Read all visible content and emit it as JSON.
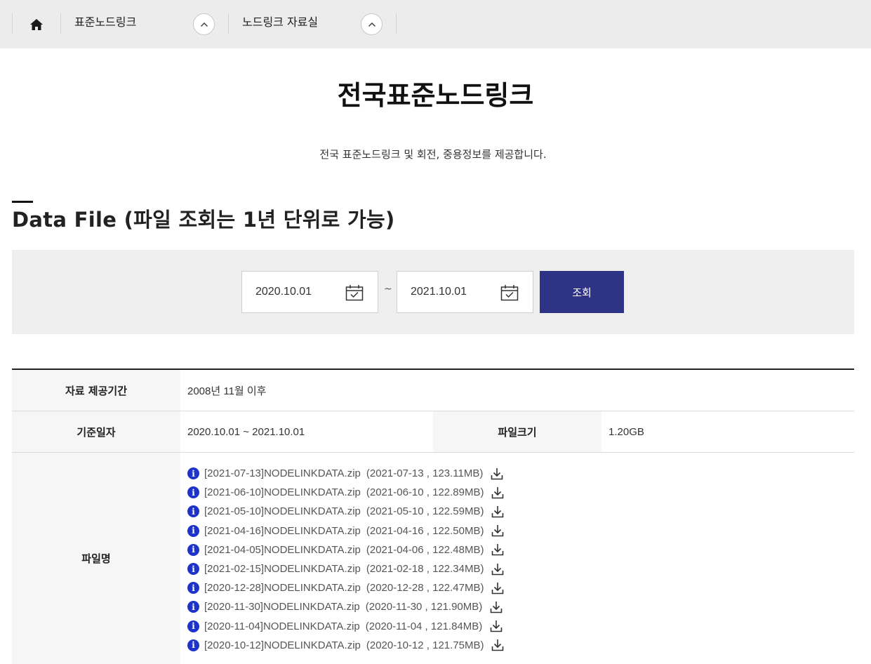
{
  "breadcrumb": {
    "level1": "표준노드링크",
    "level2": "노드링크 자료실"
  },
  "page": {
    "title": "전국표준노드링크",
    "description": "전국 표준노드링크 및 회전, 중용정보를 제공합니다."
  },
  "section": {
    "title": "Data File (파일 조회는 1년 단위로 가능)"
  },
  "search": {
    "start_date": "2020.10.01",
    "separator": "~",
    "end_date": "2021.10.01",
    "button_label": "조회"
  },
  "info": {
    "period_label": "자료 제공기간",
    "period_value": "2008년 11월 이후",
    "base_date_label": "기준일자",
    "base_date_value": "2020.10.01 ~ 2021.10.01",
    "size_label": "파일크기",
    "size_value": "1.20GB",
    "files_label": "파일명"
  },
  "files": [
    {
      "name": "[2021-07-13]NODELINKDATA.zip",
      "meta": "(2021-07-13 , 123.11MB)"
    },
    {
      "name": "[2021-06-10]NODELINKDATA.zip",
      "meta": "(2021-06-10 , 122.89MB)"
    },
    {
      "name": "[2021-05-10]NODELINKDATA.zip",
      "meta": "(2021-05-10 , 122.59MB)"
    },
    {
      "name": "[2021-04-16]NODELINKDATA.zip",
      "meta": "(2021-04-16 , 122.50MB)"
    },
    {
      "name": "[2021-04-05]NODELINKDATA.zip",
      "meta": "(2021-04-06 , 122.48MB)"
    },
    {
      "name": "[2021-02-15]NODELINKDATA.zip",
      "meta": "(2021-02-18 , 122.34MB)"
    },
    {
      "name": "[2020-12-28]NODELINKDATA.zip",
      "meta": "(2020-12-28 , 122.47MB)"
    },
    {
      "name": "[2020-11-30]NODELINKDATA.zip",
      "meta": "(2020-11-30 , 121.90MB)"
    },
    {
      "name": "[2020-11-04]NODELINKDATA.zip",
      "meta": "(2020-11-04 , 121.84MB)"
    },
    {
      "name": "[2020-10-12]NODELINKDATA.zip",
      "meta": "(2020-10-12 , 121.75MB)"
    }
  ],
  "icons": {
    "home": "home-icon",
    "toggle": "chevron-up-icon",
    "calendar": "calendar-icon",
    "info": "info-icon",
    "download": "download-icon"
  },
  "colors": {
    "accent": "#2f3386",
    "info_icon": "#1d33c9",
    "topbar_bg": "#ececec",
    "search_bg": "#efefef"
  }
}
